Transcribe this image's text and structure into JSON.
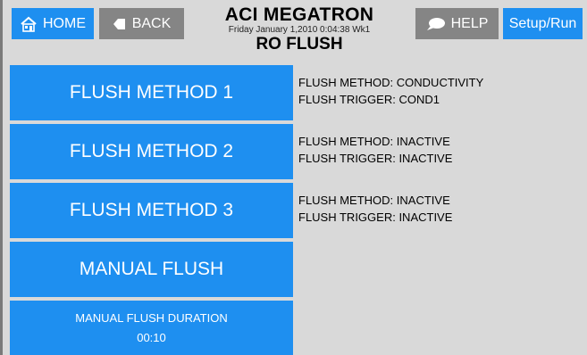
{
  "header": {
    "home_label": "HOME",
    "back_label": "BACK",
    "help_label": "HELP",
    "setup_label": "Setup/Run",
    "app_title": "ACI MEGATRON",
    "datetime": "Friday January 1,2010 0:04:38 Wk1",
    "page_title": "RO FLUSH"
  },
  "flush_buttons": [
    {
      "label": "FLUSH METHOD 1",
      "method": "FLUSH METHOD: CONDUCTIVITY",
      "trigger": "FLUSH TRIGGER: COND1"
    },
    {
      "label": "FLUSH METHOD 2",
      "method": "FLUSH METHOD: INACTIVE",
      "trigger": "FLUSH TRIGGER: INACTIVE"
    },
    {
      "label": "FLUSH METHOD 3",
      "method": "FLUSH METHOD: INACTIVE",
      "trigger": "FLUSH TRIGGER: INACTIVE"
    }
  ],
  "manual": {
    "label": "MANUAL FLUSH",
    "duration_label": "MANUAL FLUSH DURATION",
    "duration_value": "00:10"
  },
  "icons": {
    "home": "home-icon",
    "back": "back-arrow-icon",
    "help": "speech-bubble-icon"
  },
  "colors": {
    "button_blue": "#1e8ff0",
    "button_gray": "#858585",
    "background": "#d9d9d9"
  }
}
